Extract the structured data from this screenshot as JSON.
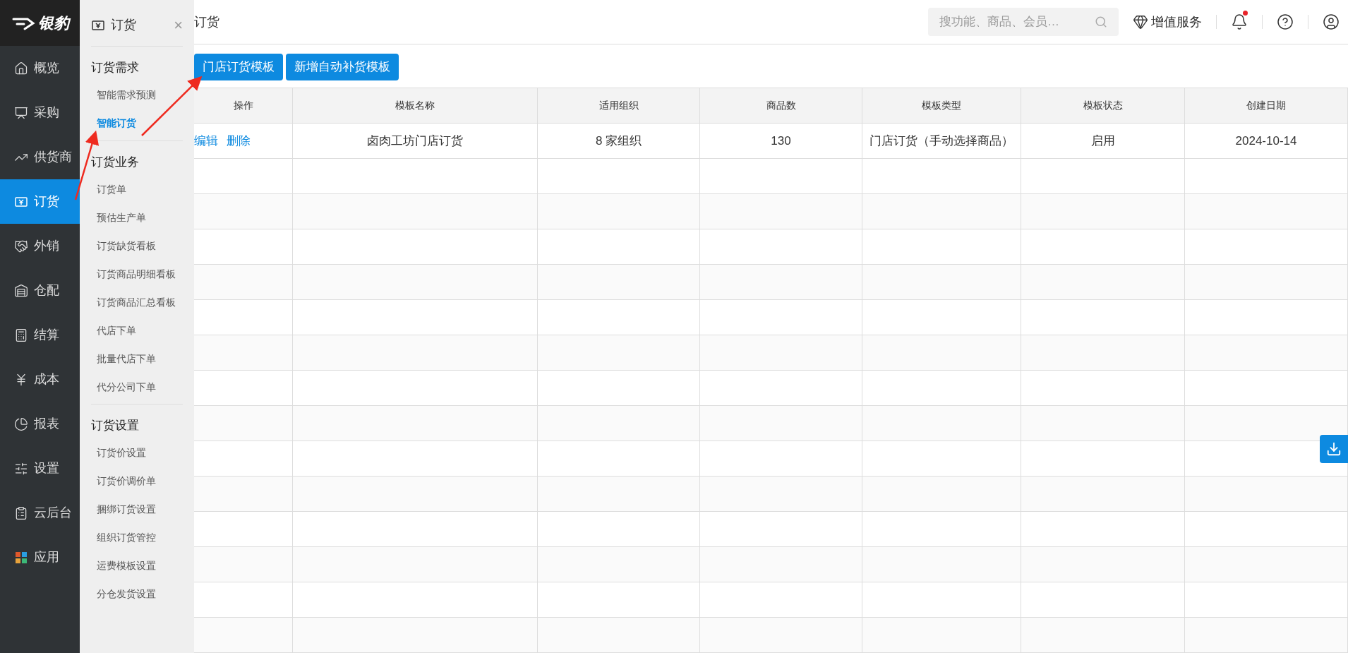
{
  "logo": {
    "text": "银豹"
  },
  "nav": [
    {
      "label": "概览",
      "selected": false
    },
    {
      "label": "采购",
      "selected": false
    },
    {
      "label": "供货商",
      "selected": false
    },
    {
      "label": "订货",
      "selected": true
    },
    {
      "label": "外销",
      "selected": false
    },
    {
      "label": "仓配",
      "selected": false
    },
    {
      "label": "结算",
      "selected": false
    },
    {
      "label": "成本",
      "selected": false
    },
    {
      "label": "报表",
      "selected": false
    },
    {
      "label": "设置",
      "selected": false
    },
    {
      "label": "云后台",
      "selected": false
    },
    {
      "label": "应用",
      "selected": false
    }
  ],
  "submenu": {
    "title": "订货",
    "close": "×",
    "groups": [
      {
        "title": "订货需求",
        "items": [
          {
            "label": "智能需求预测",
            "selected": false
          },
          {
            "label": "智能订货",
            "selected": true
          }
        ]
      },
      {
        "title": "订货业务",
        "items": [
          {
            "label": "订货单",
            "selected": false
          },
          {
            "label": "预估生产单",
            "selected": false
          },
          {
            "label": "订货缺货看板",
            "selected": false
          },
          {
            "label": "订货商品明细看板",
            "selected": false
          },
          {
            "label": "订货商品汇总看板",
            "selected": false
          },
          {
            "label": "代店下单",
            "selected": false
          },
          {
            "label": "批量代店下单",
            "selected": false
          },
          {
            "label": "代分公司下单",
            "selected": false
          }
        ]
      },
      {
        "title": "订货设置",
        "items": [
          {
            "label": "订货价设置",
            "selected": false
          },
          {
            "label": "订货价调价单",
            "selected": false
          },
          {
            "label": "捆绑订货设置",
            "selected": false
          },
          {
            "label": "组织订货管控",
            "selected": false
          },
          {
            "label": "运费模板设置",
            "selected": false
          },
          {
            "label": "分仓发货设置",
            "selected": false
          }
        ]
      }
    ]
  },
  "header": {
    "title": "订货",
    "search": {
      "placeholder": "搜功能、商品、会员…"
    },
    "value_added": "增值服务",
    "notification_dot": true
  },
  "buttons": [
    "门店订货模板",
    "新增自动补货模板"
  ],
  "table": {
    "columns": [
      "操作",
      "模板名称",
      "适用组织",
      "商品数",
      "模板类型",
      "模板状态",
      "创建日期"
    ],
    "rows": [
      {
        "cells": [
          [
            "编辑",
            "删除"
          ],
          "卤肉工坊门店订货",
          "8 家组织",
          "130",
          "门店订货（手动选择商品）",
          "启用",
          "2024-10-14"
        ]
      }
    ]
  }
}
